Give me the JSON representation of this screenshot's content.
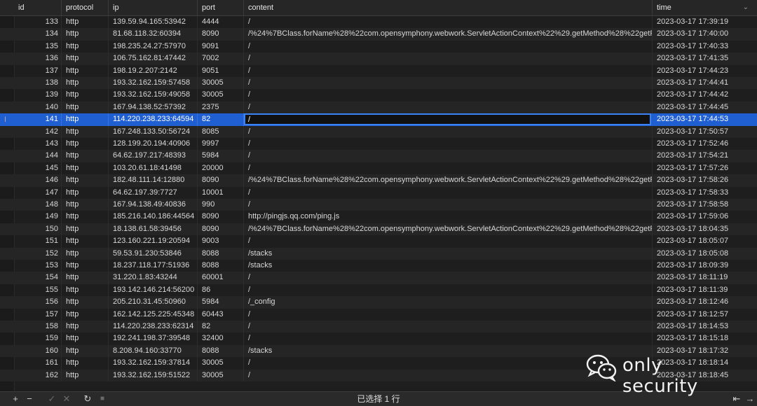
{
  "columns": [
    "id",
    "protocol",
    "ip",
    "port",
    "content",
    "time"
  ],
  "rows": [
    {
      "id": "133",
      "protocol": "http",
      "ip": "139.59.94.165:53942",
      "port": "4444",
      "content": "/",
      "time": "2023-03-17 17:39:19"
    },
    {
      "id": "134",
      "protocol": "http",
      "ip": "81.68.118.32:60394",
      "port": "8090",
      "content": "/%24%7BClass.forName%28%22com.opensymphony.webwork.ServletActionContext%22%29.getMethod%28%22getRe",
      "time": "2023-03-17 17:40:00"
    },
    {
      "id": "135",
      "protocol": "http",
      "ip": "198.235.24.27:57970",
      "port": "9091",
      "content": "/",
      "time": "2023-03-17 17:40:33"
    },
    {
      "id": "136",
      "protocol": "http",
      "ip": "106.75.162.81:47442",
      "port": "7002",
      "content": "/",
      "time": "2023-03-17 17:41:35"
    },
    {
      "id": "137",
      "protocol": "http",
      "ip": "198.19.2.207:2142",
      "port": "9051",
      "content": "/",
      "time": "2023-03-17 17:44:23"
    },
    {
      "id": "138",
      "protocol": "http",
      "ip": "193.32.162.159:57458",
      "port": "30005",
      "content": "/",
      "time": "2023-03-17 17:44:41"
    },
    {
      "id": "139",
      "protocol": "http",
      "ip": "193.32.162.159:49058",
      "port": "30005",
      "content": "/",
      "time": "2023-03-17 17:44:42"
    },
    {
      "id": "140",
      "protocol": "http",
      "ip": "167.94.138.52:57392",
      "port": "2375",
      "content": "/",
      "time": "2023-03-17 17:44:45"
    },
    {
      "id": "141",
      "protocol": "http",
      "ip": "114.220.238.233:64594",
      "port": "82",
      "content": "/",
      "time": "2023-03-17 17:44:53"
    },
    {
      "id": "142",
      "protocol": "http",
      "ip": "167.248.133.50:56724",
      "port": "8085",
      "content": "/",
      "time": "2023-03-17 17:50:57"
    },
    {
      "id": "143",
      "protocol": "http",
      "ip": "128.199.20.194:40906",
      "port": "9997",
      "content": "/",
      "time": "2023-03-17 17:52:46"
    },
    {
      "id": "144",
      "protocol": "http",
      "ip": "64.62.197.217:48393",
      "port": "5984",
      "content": "/",
      "time": "2023-03-17 17:54:21"
    },
    {
      "id": "145",
      "protocol": "http",
      "ip": "103.20.61.18:41498",
      "port": "20000",
      "content": "/",
      "time": "2023-03-17 17:57:26"
    },
    {
      "id": "146",
      "protocol": "http",
      "ip": "182.48.111.14:12880",
      "port": "8090",
      "content": "/%24%7BClass.forName%28%22com.opensymphony.webwork.ServletActionContext%22%29.getMethod%28%22getRe",
      "time": "2023-03-17 17:58:26"
    },
    {
      "id": "147",
      "protocol": "http",
      "ip": "64.62.197.39:7727",
      "port": "10001",
      "content": "/",
      "time": "2023-03-17 17:58:33"
    },
    {
      "id": "148",
      "protocol": "http",
      "ip": "167.94.138.49:40836",
      "port": "990",
      "content": "/",
      "time": "2023-03-17 17:58:58"
    },
    {
      "id": "149",
      "protocol": "http",
      "ip": "185.216.140.186:44564",
      "port": "8090",
      "content": "http://pingjs.qq.com/ping.js",
      "time": "2023-03-17 17:59:06"
    },
    {
      "id": "150",
      "protocol": "http",
      "ip": "18.138.61.58:39456",
      "port": "8090",
      "content": "/%24%7BClass.forName%28%22com.opensymphony.webwork.ServletActionContext%22%29.getMethod%28%22getRe",
      "time": "2023-03-17 18:04:35"
    },
    {
      "id": "151",
      "protocol": "http",
      "ip": "123.160.221.19:20594",
      "port": "9003",
      "content": "/",
      "time": "2023-03-17 18:05:07"
    },
    {
      "id": "152",
      "protocol": "http",
      "ip": "59.53.91.230:53846",
      "port": "8088",
      "content": "/stacks",
      "time": "2023-03-17 18:05:08"
    },
    {
      "id": "153",
      "protocol": "http",
      "ip": "18.237.118.177:51936",
      "port": "8088",
      "content": "/stacks",
      "time": "2023-03-17 18:09:39"
    },
    {
      "id": "154",
      "protocol": "http",
      "ip": "31.220.1.83:43244",
      "port": "60001",
      "content": "/",
      "time": "2023-03-17 18:11:19"
    },
    {
      "id": "155",
      "protocol": "http",
      "ip": "193.142.146.214:56200",
      "port": "86",
      "content": "/",
      "time": "2023-03-17 18:11:39"
    },
    {
      "id": "156",
      "protocol": "http",
      "ip": "205.210.31.45:50960",
      "port": "5984",
      "content": "/_config",
      "time": "2023-03-17 18:12:46"
    },
    {
      "id": "157",
      "protocol": "http",
      "ip": "162.142.125.225:45348",
      "port": "60443",
      "content": "/",
      "time": "2023-03-17 18:12:57"
    },
    {
      "id": "158",
      "protocol": "http",
      "ip": "114.220.238.233:62314",
      "port": "82",
      "content": "/",
      "time": "2023-03-17 18:14:53"
    },
    {
      "id": "159",
      "protocol": "http",
      "ip": "192.241.198.37:39548",
      "port": "32400",
      "content": "/",
      "time": "2023-03-17 18:15:18"
    },
    {
      "id": "160",
      "protocol": "http",
      "ip": "8.208.94.160:33770",
      "port": "8088",
      "content": "/stacks",
      "time": "2023-03-17 18:17:32"
    },
    {
      "id": "161",
      "protocol": "http",
      "ip": "193.32.162.159:37814",
      "port": "30005",
      "content": "/",
      "time": "2023-03-17 18:18:14"
    },
    {
      "id": "162",
      "protocol": "http",
      "ip": "193.32.162.159:51522",
      "port": "30005",
      "content": "/",
      "time": "2023-03-17 18:18:45"
    }
  ],
  "selected_row_id": "141",
  "editing_value": "/",
  "footer": {
    "status": "已选择 1 行",
    "add_icon": "+",
    "remove_icon": "−",
    "commit_icon": "✓",
    "discard_icon": "✕",
    "refresh_icon": "↻",
    "stop_icon": "■",
    "first_icon": "⇤",
    "next_icon": "→"
  },
  "watermark": {
    "text": "only security",
    "icon": "wechat-icon"
  },
  "colors": {
    "selection": "#1f5fd1",
    "edit_border": "#3b82f6",
    "background": "#1e1e1e"
  }
}
